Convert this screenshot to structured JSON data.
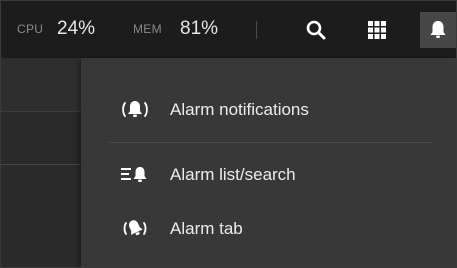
{
  "topbar": {
    "cpu": {
      "label": "CPU",
      "value": "24%"
    },
    "mem": {
      "label": "MEM",
      "value": "81%"
    },
    "icons": [
      "search-icon",
      "apps-grid-icon",
      "bell-icon"
    ]
  },
  "alarm_menu": {
    "items": [
      {
        "label": "Alarm notifications",
        "icon": "alarm-ringing-icon"
      },
      {
        "label": "Alarm list/search",
        "icon": "alarm-list-icon"
      },
      {
        "label": "Alarm tab",
        "icon": "alarm-tab-icon"
      }
    ]
  },
  "colors": {
    "topbar_bg": "#1c1c1c",
    "menu_bg": "#383838",
    "active_bell_bg": "#474747",
    "text": "#ececec",
    "muted_text": "#8a8a8a"
  }
}
